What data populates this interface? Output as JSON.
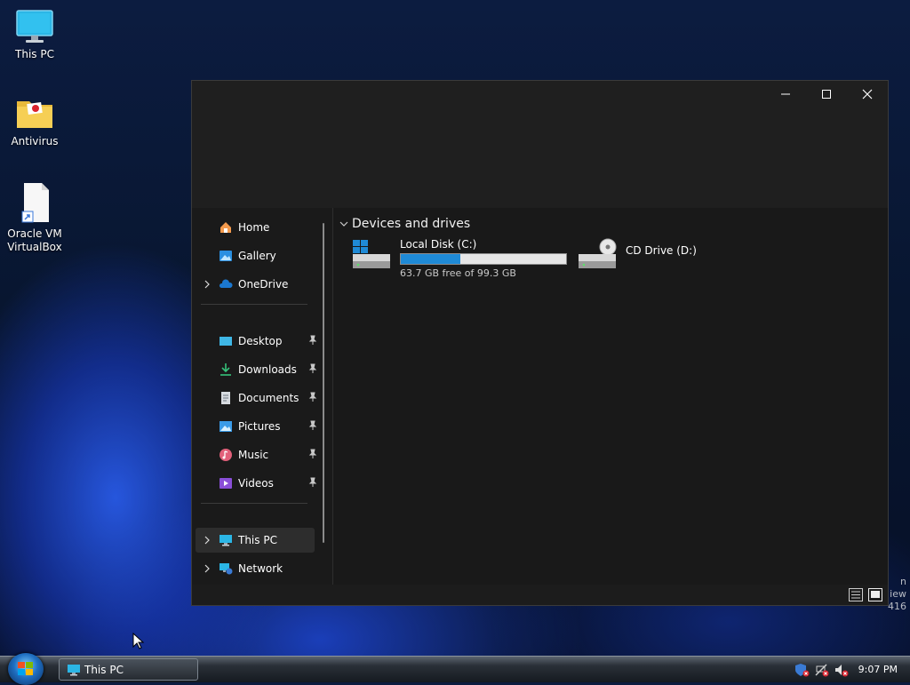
{
  "desktop": {
    "icons": [
      {
        "label": "This PC",
        "icon": "monitor-icon"
      },
      {
        "label": "Antivirus",
        "icon": "folder-icon"
      },
      {
        "label": "Oracle VM VirtualBox",
        "icon": "shortcut-file-icon"
      }
    ],
    "watermark_lines": [
      "n",
      "iew",
      "416"
    ]
  },
  "window": {
    "controls": {
      "minimize": "minimize-icon",
      "maximize": "maximize-icon",
      "close": "close-icon"
    },
    "nav": {
      "quick": [
        {
          "label": "Home",
          "icon": "home-icon",
          "expandable": false
        },
        {
          "label": "Gallery",
          "icon": "gallery-icon",
          "expandable": false
        },
        {
          "label": "OneDrive",
          "icon": "cloud-icon",
          "expandable": true
        }
      ],
      "pinned": [
        {
          "label": "Desktop",
          "icon": "desktop-folder-icon"
        },
        {
          "label": "Downloads",
          "icon": "download-icon"
        },
        {
          "label": "Documents",
          "icon": "documents-icon"
        },
        {
          "label": "Pictures",
          "icon": "pictures-icon"
        },
        {
          "label": "Music",
          "icon": "music-icon"
        },
        {
          "label": "Videos",
          "icon": "videos-icon"
        }
      ],
      "locations": [
        {
          "label": "This PC",
          "icon": "monitor-icon",
          "expandable": true,
          "selected": true
        },
        {
          "label": "Network",
          "icon": "network-icon",
          "expandable": true,
          "selected": false
        }
      ]
    },
    "content": {
      "section_title": "Devices and drives",
      "drives": [
        {
          "name": "Local Disk (C:)",
          "free_text": "63.7 GB free of 99.3 GB",
          "used_fraction": 0.358,
          "icon": "hard-drive-windows-icon"
        },
        {
          "name": "CD Drive (D:)",
          "icon": "cd-drive-icon"
        }
      ]
    },
    "statusbar": {
      "views": [
        "details-view-icon",
        "large-icons-view-icon"
      ]
    }
  },
  "taskbar": {
    "start": "start-orb-icon",
    "task_button": {
      "label": "This PC",
      "icon": "monitor-icon"
    },
    "tray": {
      "icons": [
        "security-alert-icon",
        "network-off-icon",
        "volume-muted-icon"
      ],
      "clock": "9:07 PM"
    }
  },
  "colors": {
    "accent": "#1f8ad6",
    "window_bg": "#1c1c1c",
    "selection": "#2d2d2d"
  }
}
